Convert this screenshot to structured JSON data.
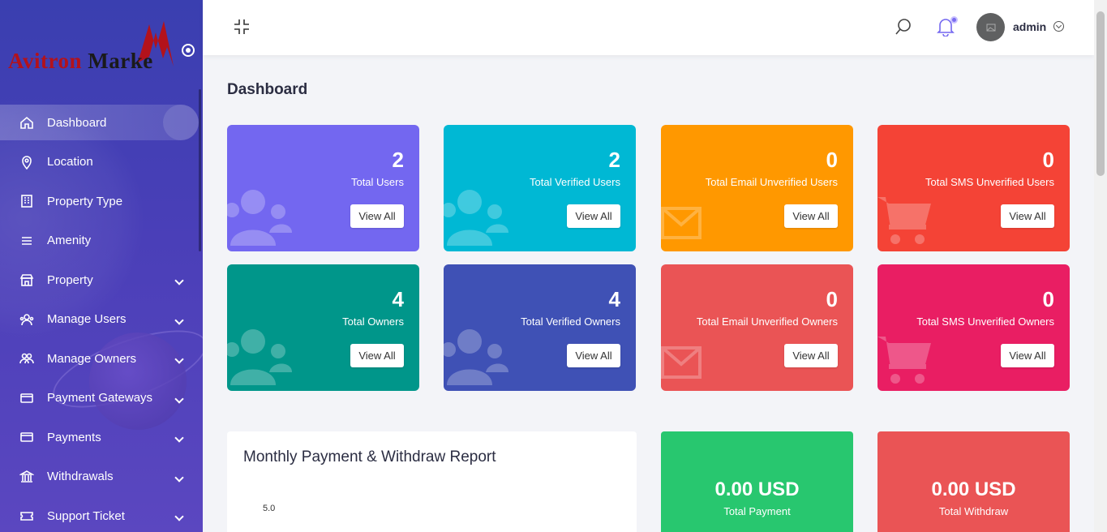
{
  "brand": {
    "logo_text_a": "Avitron ",
    "logo_text_b": "Marke"
  },
  "sidebar": {
    "items": [
      {
        "label": "Dashboard",
        "icon": "home-icon",
        "active": true,
        "has_chevron": false
      },
      {
        "label": "Location",
        "icon": "location-pin-icon",
        "active": false,
        "has_chevron": false
      },
      {
        "label": "Property Type",
        "icon": "building-icon",
        "active": false,
        "has_chevron": false
      },
      {
        "label": "Amenity",
        "icon": "list-icon",
        "active": false,
        "has_chevron": false
      },
      {
        "label": "Property",
        "icon": "store-icon",
        "active": false,
        "has_chevron": true
      },
      {
        "label": "Manage Users",
        "icon": "users-cog-icon",
        "active": false,
        "has_chevron": true
      },
      {
        "label": "Manage Owners",
        "icon": "user-group-icon",
        "active": false,
        "has_chevron": true
      },
      {
        "label": "Payment Gateways",
        "icon": "credit-card-icon",
        "active": false,
        "has_chevron": true
      },
      {
        "label": "Payments",
        "icon": "credit-card-icon",
        "active": false,
        "has_chevron": true
      },
      {
        "label": "Withdrawals",
        "icon": "bank-icon",
        "active": false,
        "has_chevron": true
      },
      {
        "label": "Support Ticket",
        "icon": "ticket-icon",
        "active": false,
        "has_chevron": true
      }
    ]
  },
  "header": {
    "user_name": "admin",
    "notification_dot": true
  },
  "page": {
    "title": "Dashboard"
  },
  "cards": [
    {
      "value": "2",
      "label": "Total Users",
      "button": "View All",
      "color": "#7367f0",
      "icon": "users-icon"
    },
    {
      "value": "2",
      "label": "Total Verified Users",
      "button": "View All",
      "color": "#00b8d4",
      "icon": "users-icon"
    },
    {
      "value": "0",
      "label": "Total Email Unverified Users",
      "button": "View All",
      "color": "#ff9800",
      "icon": "envelope-icon"
    },
    {
      "value": "0",
      "label": "Total SMS Unverified Users",
      "button": "View All",
      "color": "#f44336",
      "icon": "cart-icon"
    },
    {
      "value": "4",
      "label": "Total Owners",
      "button": "View All",
      "color": "#00968a",
      "icon": "users-icon"
    },
    {
      "value": "4",
      "label": "Total Verified Owners",
      "button": "View All",
      "color": "#3f51b5",
      "icon": "users-icon"
    },
    {
      "value": "0",
      "label": "Total Email Unverified Owners",
      "button": "View All",
      "color": "#ea5455",
      "icon": "envelope-icon"
    },
    {
      "value": "0",
      "label": "Total SMS Unverified Owners",
      "button": "View All",
      "color": "#e91e63",
      "icon": "cart-icon"
    }
  ],
  "report": {
    "title": "Monthly Payment & Withdraw Report",
    "y_tick": "5.0"
  },
  "totals": [
    {
      "amount": "0.00 USD",
      "label": "Total Payment",
      "color": "#28c76f"
    },
    {
      "amount": "0.00 USD",
      "label": "Total Withdraw",
      "color": "#ea5455"
    }
  ]
}
